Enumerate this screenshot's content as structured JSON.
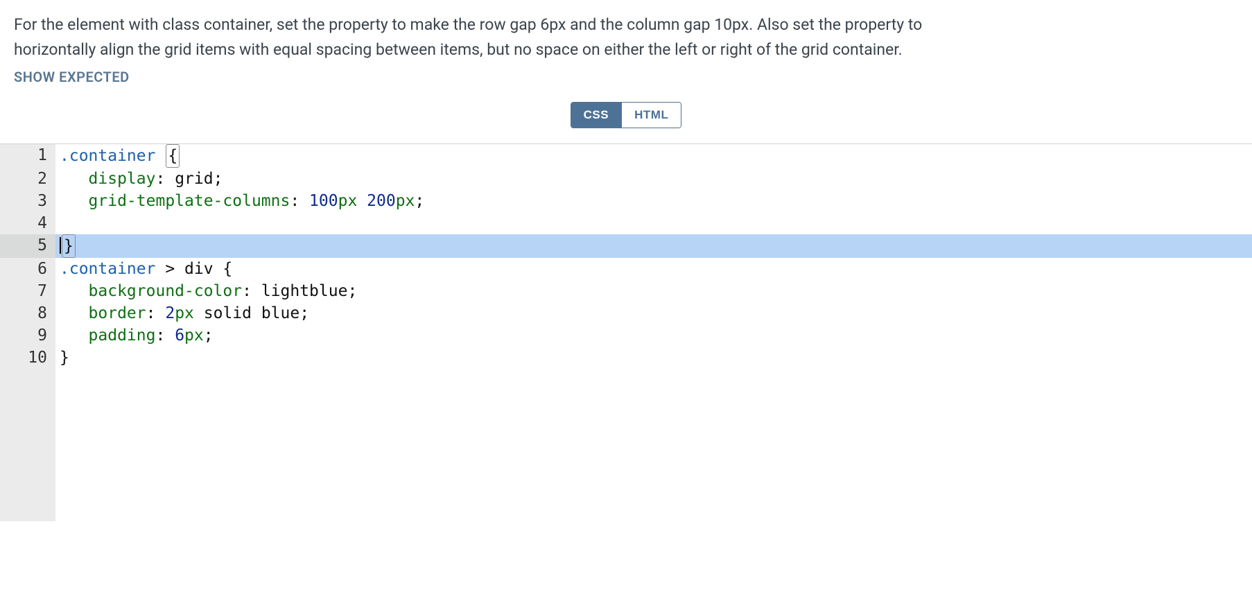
{
  "instructions": {
    "line1": "For the element with class container, set the property to make the row gap 6px and the column gap 10px. Also set the property to",
    "line2": "horizontally align the grid items with equal spacing between items, but no space on either the left or right of the grid container."
  },
  "showExpected": "SHOW EXPECTED",
  "tabs": {
    "css": "CSS",
    "html": "HTML",
    "active": "css"
  },
  "editor": {
    "language": "css",
    "activeLine": 5,
    "lines": [
      {
        "num": 1,
        "tokens": [
          {
            "t": ".container ",
            "c": "tok-sel"
          },
          {
            "t": "{",
            "c": "tok-punct brace-match"
          }
        ]
      },
      {
        "num": 2,
        "tokens": [
          {
            "t": "   ",
            "c": ""
          },
          {
            "t": "display",
            "c": "tok-prop"
          },
          {
            "t": ": ",
            "c": "tok-punct"
          },
          {
            "t": "grid",
            "c": "tok-val"
          },
          {
            "t": ";",
            "c": "tok-punct"
          }
        ]
      },
      {
        "num": 3,
        "tokens": [
          {
            "t": "   ",
            "c": ""
          },
          {
            "t": "grid-template-columns",
            "c": "tok-prop"
          },
          {
            "t": ": ",
            "c": "tok-punct"
          },
          {
            "t": "100",
            "c": "tok-num"
          },
          {
            "t": "px ",
            "c": "tok-unit"
          },
          {
            "t": "200",
            "c": "tok-num"
          },
          {
            "t": "px",
            "c": "tok-unit"
          },
          {
            "t": ";",
            "c": "tok-punct"
          }
        ]
      },
      {
        "num": 4,
        "tokens": []
      },
      {
        "num": 5,
        "tokens": [
          {
            "t": "}",
            "c": "tok-punct brace-match",
            "cursorBefore": true
          }
        ]
      },
      {
        "num": 6,
        "tokens": [
          {
            "t": ".container ",
            "c": "tok-sel"
          },
          {
            "t": "> ",
            "c": "tok-punct"
          },
          {
            "t": "div ",
            "c": "tok-name"
          },
          {
            "t": "{",
            "c": "tok-punct"
          }
        ]
      },
      {
        "num": 7,
        "tokens": [
          {
            "t": "   ",
            "c": ""
          },
          {
            "t": "background-color",
            "c": "tok-prop"
          },
          {
            "t": ": ",
            "c": "tok-punct"
          },
          {
            "t": "lightblue",
            "c": "tok-val"
          },
          {
            "t": ";",
            "c": "tok-punct"
          }
        ]
      },
      {
        "num": 8,
        "tokens": [
          {
            "t": "   ",
            "c": ""
          },
          {
            "t": "border",
            "c": "tok-prop"
          },
          {
            "t": ": ",
            "c": "tok-punct"
          },
          {
            "t": "2",
            "c": "tok-num"
          },
          {
            "t": "px ",
            "c": "tok-unit"
          },
          {
            "t": "solid blue",
            "c": "tok-val"
          },
          {
            "t": ";",
            "c": "tok-punct"
          }
        ]
      },
      {
        "num": 9,
        "tokens": [
          {
            "t": "   ",
            "c": ""
          },
          {
            "t": "padding",
            "c": "tok-prop"
          },
          {
            "t": ": ",
            "c": "tok-punct"
          },
          {
            "t": "6",
            "c": "tok-num"
          },
          {
            "t": "px",
            "c": "tok-unit"
          },
          {
            "t": ";",
            "c": "tok-punct"
          }
        ]
      },
      {
        "num": 10,
        "tokens": [
          {
            "t": "}",
            "c": "tok-punct"
          }
        ]
      }
    ]
  }
}
